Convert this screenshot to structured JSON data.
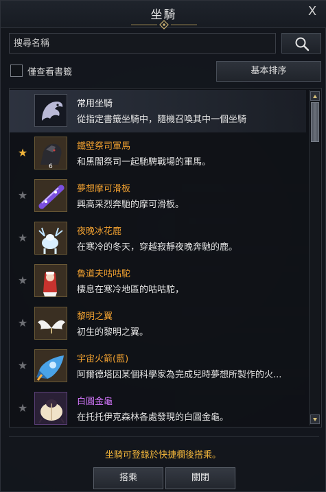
{
  "window": {
    "title": "坐騎",
    "close_label": "X"
  },
  "search": {
    "placeholder": "搜尋名稱",
    "value": ""
  },
  "filter": {
    "checkbox_label": "僅查看書籤",
    "checked": false,
    "sort_label": "基本排序"
  },
  "mounts": [
    {
      "name": "常用坐騎",
      "desc": "從指定書籤坐騎中，隨機召喚其中一個坐騎",
      "icon": "dragon-emblem-icon",
      "favorite": null,
      "name_color": "white",
      "selected": true
    },
    {
      "name": "鐵壁祭司軍馬",
      "desc": "和黑闇祭司一起馳騁戰場的軍馬。",
      "icon": "armored-warhorse-icon",
      "favorite": true,
      "name_color": "orange",
      "badge": "6"
    },
    {
      "name": "夢想摩可滑板",
      "desc": "興高采烈奔馳的摩可滑板。",
      "icon": "hoverboard-icon",
      "favorite": false,
      "name_color": "orange"
    },
    {
      "name": "夜晚冰花鹿",
      "desc": "在寒冷的冬天，穿越寂靜夜晚奔馳的鹿。",
      "icon": "ice-deer-icon",
      "favorite": false,
      "name_color": "orange"
    },
    {
      "name": "魯道夫咕咕駝",
      "desc": "棲息在寒冷地區的咕咕駝，",
      "icon": "camel-bird-icon",
      "favorite": false,
      "name_color": "orange"
    },
    {
      "name": "黎明之翼",
      "desc": "初生的黎明之翼。",
      "icon": "white-wings-icon",
      "favorite": false,
      "name_color": "orange"
    },
    {
      "name": "宇宙火箭(藍)",
      "desc": "阿爾德塔因某個科學家為完成兒時夢想所製作的火...",
      "icon": "blue-rocket-icon",
      "favorite": false,
      "name_color": "orange"
    },
    {
      "name": "白圓金龜",
      "desc": "在托托伊克森林各處發現的白圓金龜。",
      "icon": "white-beetle-icon",
      "favorite": false,
      "name_color": "purple"
    }
  ],
  "footer": {
    "hint": "坐騎可登錄於快捷欄後搭乘。",
    "ride_label": "搭乘",
    "close_label": "關閉"
  },
  "colors": {
    "legendary": "#f0a030",
    "epic": "#d678ff",
    "hint": "#f0b43a",
    "favorite_star": "#f0b43a"
  }
}
